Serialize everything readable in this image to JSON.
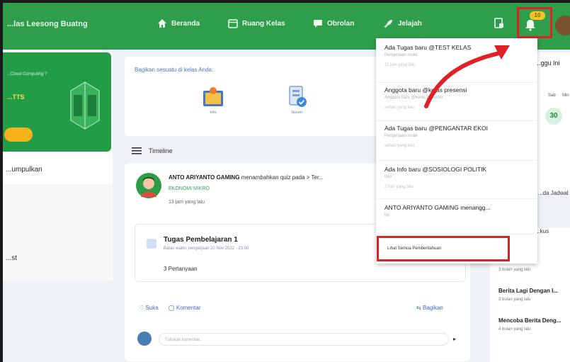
{
  "header": {
    "brand": "...las Leesong Buatng",
    "nav": [
      {
        "label": "Beranda",
        "icon": "home-icon"
      },
      {
        "label": "Ruang Kelas",
        "icon": "calendar-icon"
      },
      {
        "label": "Obrolan",
        "icon": "chat-icon"
      },
      {
        "label": "Jelajah",
        "icon": "rocket-icon"
      }
    ],
    "notification_count": "10"
  },
  "banner": {
    "line1": "...Cloud Computing ?",
    "line2": "...TTS"
  },
  "left": {
    "section_title": "...umpulkan",
    "item_text": "...st"
  },
  "share": {
    "title": "Bagikan sesuatu di kelas Anda:",
    "items": [
      "Info",
      "Survei"
    ]
  },
  "timeline": {
    "label": "Timeline",
    "post": {
      "author": "ANTO ARIYANTO GAMING",
      "action": "menambahkan quiz pada > Ter...",
      "class": "EKONOMI MIKRO",
      "time": "13 jam yang lalu",
      "task_title": "Tugas Pembelajaran 1",
      "task_sub": "Batas waktu pengerjaan 20 Nov 2022 - 23:00",
      "task_questions": "3 Pertanyaan",
      "like": "Suka",
      "comment": "Komentar",
      "share": "Bagikan",
      "comment_placeholder": "Tuliskan komentar..."
    }
  },
  "right": {
    "title": "...ggu Ini",
    "days": [
      "Sab",
      "Min"
    ],
    "date": "30",
    "jadwal": "...da Jadwal",
    "section": "...kus",
    "news": [
      {
        "title": "...",
        "time": "3 bulan yang lalu"
      },
      {
        "title": "Berita Lagi Dengan I...",
        "time": "3 bulan yang lalu"
      },
      {
        "title": "Mencoba Berita Deng...",
        "time": "4 bulan yang lalu"
      }
    ]
  },
  "notifications": {
    "items": [
      {
        "title": "Ada Tugas baru @TEST KELAS",
        "sub": "Pengerjaan mulai",
        "time": "11 jam yang lalu"
      },
      {
        "title": "Anggota baru @kelas presensi",
        "sub": "Anggota baru @kelas presensi",
        "time": "sehari yang lalu"
      },
      {
        "title": "Ada Tugas baru @PENGANTAR EKOI",
        "sub": "Pengerjaan mulai",
        "time": "sehari yang lalu"
      },
      {
        "title": "Ada Info baru @SOSIOLOGI POLITIK",
        "sub": "Info",
        "time": "2 hari yang lalu"
      },
      {
        "title": "ANTO ARIYANTO GAMING menangg...",
        "sub": "Ini",
        "time": ""
      }
    ],
    "see_all": "Lihat Semua Pemberitahuan"
  }
}
